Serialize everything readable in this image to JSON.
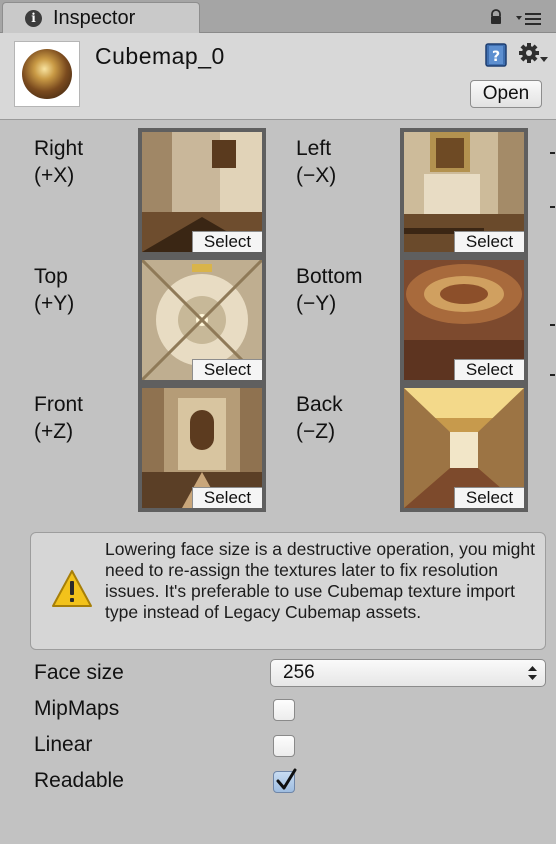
{
  "tab": {
    "title": "Inspector",
    "icon": "info-icon"
  },
  "header": {
    "asset_name": "Cubemap_0",
    "open_label": "Open"
  },
  "faces": [
    {
      "name": "Right",
      "axis": "(+X)",
      "select_label": "Select"
    },
    {
      "name": "Left",
      "axis": "(−X)",
      "select_label": "Select"
    },
    {
      "name": "Top",
      "axis": "(+Y)",
      "select_label": "Select"
    },
    {
      "name": "Bottom",
      "axis": "(−Y)",
      "select_label": "Select"
    },
    {
      "name": "Front",
      "axis": "(+Z)",
      "select_label": "Select"
    },
    {
      "name": "Back",
      "axis": "(−Z)",
      "select_label": "Select"
    }
  ],
  "warning": {
    "text": "Lowering face size is a destructive operation, you might need to re-assign the textures later to fix resolution issues. It's preferable to use Cubemap texture import type instead of Legacy Cubemap assets."
  },
  "settings": {
    "face_size_label": "Face size",
    "face_size_value": "256",
    "mipmaps_label": "MipMaps",
    "mipmaps_checked": false,
    "linear_label": "Linear",
    "linear_checked": false,
    "readable_label": "Readable",
    "readable_checked": true
  },
  "colors": {
    "panel_bg": "#c2c2c2",
    "warning_icon": "#f2c21b",
    "checkbox_checked": "#9fbde0"
  }
}
